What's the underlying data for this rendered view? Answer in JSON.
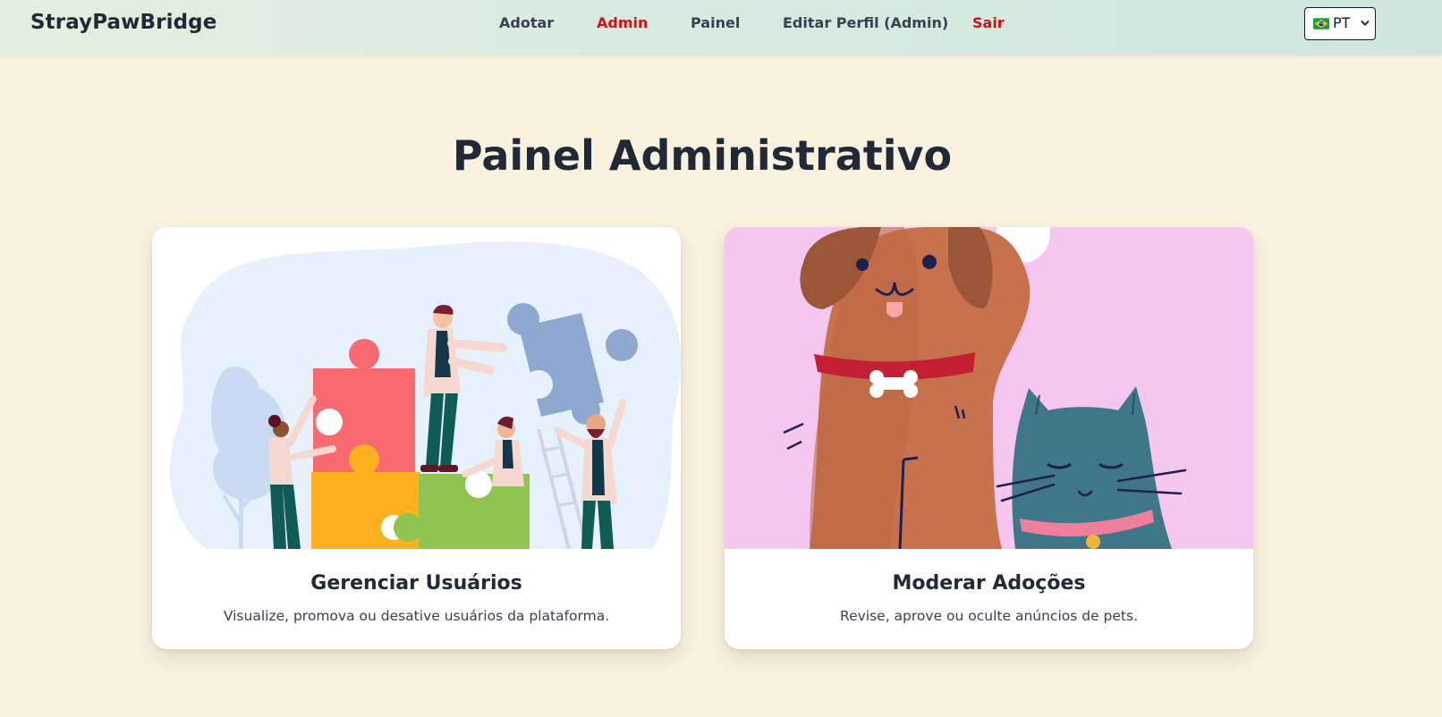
{
  "navbar": {
    "brand": "StrayPawBridge",
    "links": [
      {
        "label": "Adotar",
        "color": "#374151"
      },
      {
        "label": "Admin",
        "color": "#d10f16"
      },
      {
        "label": "Painel",
        "color": "#374151"
      },
      {
        "label": "Editar Perfil (Admin)",
        "color": "#374151"
      },
      {
        "label": "Sair",
        "color": "#d10f16"
      }
    ],
    "language": {
      "flag_icon": "brazil-flag-icon",
      "selected": "PT"
    }
  },
  "page": {
    "title": "Painel Administrativo"
  },
  "cards": [
    {
      "title": "Gerenciar Usuários",
      "description": "Visualize, promova ou desative usuários da plataforma.",
      "illustration": "people-assembling-puzzle-illustration"
    },
    {
      "title": "Moderar Adoções",
      "description": "Revise, aprove ou oculte anúncios de pets.",
      "illustration": "dog-and-cat-illustration"
    }
  ],
  "colors": {
    "background": "#faf1de",
    "accent_red": "#d10f16",
    "text_dark": "#1f2937"
  }
}
